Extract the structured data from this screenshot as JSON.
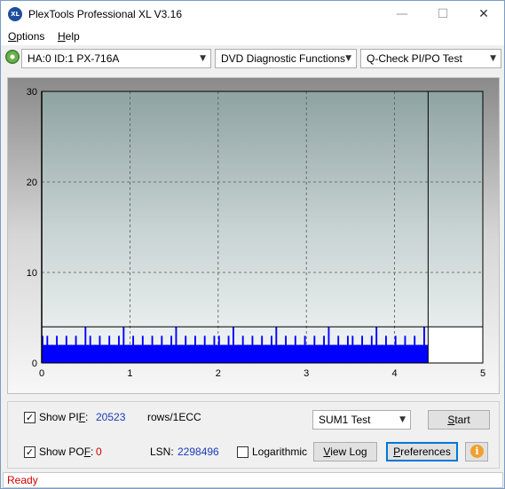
{
  "window": {
    "title": "PlexTools Professional XL V3.16",
    "app_icon_text": "XL",
    "minimize_glyph": "—",
    "maximize_glyph": "☐",
    "close_glyph": "✕"
  },
  "menu": {
    "options_first": "O",
    "options_rest": "ptions",
    "help_first": "H",
    "help_rest": "elp"
  },
  "toolbar": {
    "drive": "HA:0 ID:1  PX-716A",
    "function": "DVD Diagnostic Functions",
    "test": "Q-Check PI/PO Test"
  },
  "chart_data": {
    "type": "bar",
    "title": "",
    "xlabel": "",
    "ylabel": "",
    "xlim": [
      0,
      5
    ],
    "ylim": [
      0,
      30
    ],
    "x_ticks": [
      "0",
      "1",
      "2",
      "3",
      "4",
      "5"
    ],
    "y_ticks": [
      "0",
      "10",
      "20",
      "30"
    ],
    "grid": true,
    "scan_end_x": 4.38,
    "threshold_y": 4,
    "bar_color": "#0000ff",
    "series": [
      {
        "values_description_base_level": 2,
        "values": [
          3,
          3,
          2,
          3,
          2,
          3,
          2,
          3,
          2,
          4,
          3,
          2,
          3,
          2,
          3,
          2,
          3,
          4,
          2,
          3,
          2,
          3,
          2,
          3,
          2,
          3,
          2,
          3,
          4,
          2,
          3,
          2,
          3,
          2,
          3,
          2,
          3,
          3,
          2,
          3,
          4,
          2,
          3,
          2,
          3,
          2,
          3,
          2,
          3,
          4,
          2,
          3,
          2,
          3,
          2,
          3,
          2,
          3,
          2,
          3,
          4,
          2,
          3,
          2,
          3,
          3,
          2,
          3,
          2,
          3,
          4,
          2,
          3,
          2,
          3,
          2,
          3,
          2,
          3,
          2,
          4
        ]
      }
    ]
  },
  "pif": {
    "label_prefix": "Show PI",
    "label_underlined": "F",
    "label_suffix": ":",
    "value": "20523",
    "unit": "rows/1ECC",
    "checked": true
  },
  "pof": {
    "label_prefix": "Show PO",
    "label_underlined": "F",
    "label_suffix": ":",
    "value": "0",
    "checked": true
  },
  "lsn": {
    "label": "LSN:",
    "value": "2298496"
  },
  "logarithmic": {
    "label": "Logarithmic",
    "checked": false
  },
  "sum_select": "SUM1 Test",
  "buttons": {
    "start_first": "S",
    "start_rest": "tart",
    "view_log_first": "V",
    "view_log_rest": "iew Log",
    "preferences_first": "P",
    "preferences_rest": "references",
    "info_glyph": "i"
  },
  "status": "Ready",
  "colors": {
    "status": "#d00000",
    "pif_value": "#1a3ab8",
    "pof_value": "#d00000"
  }
}
